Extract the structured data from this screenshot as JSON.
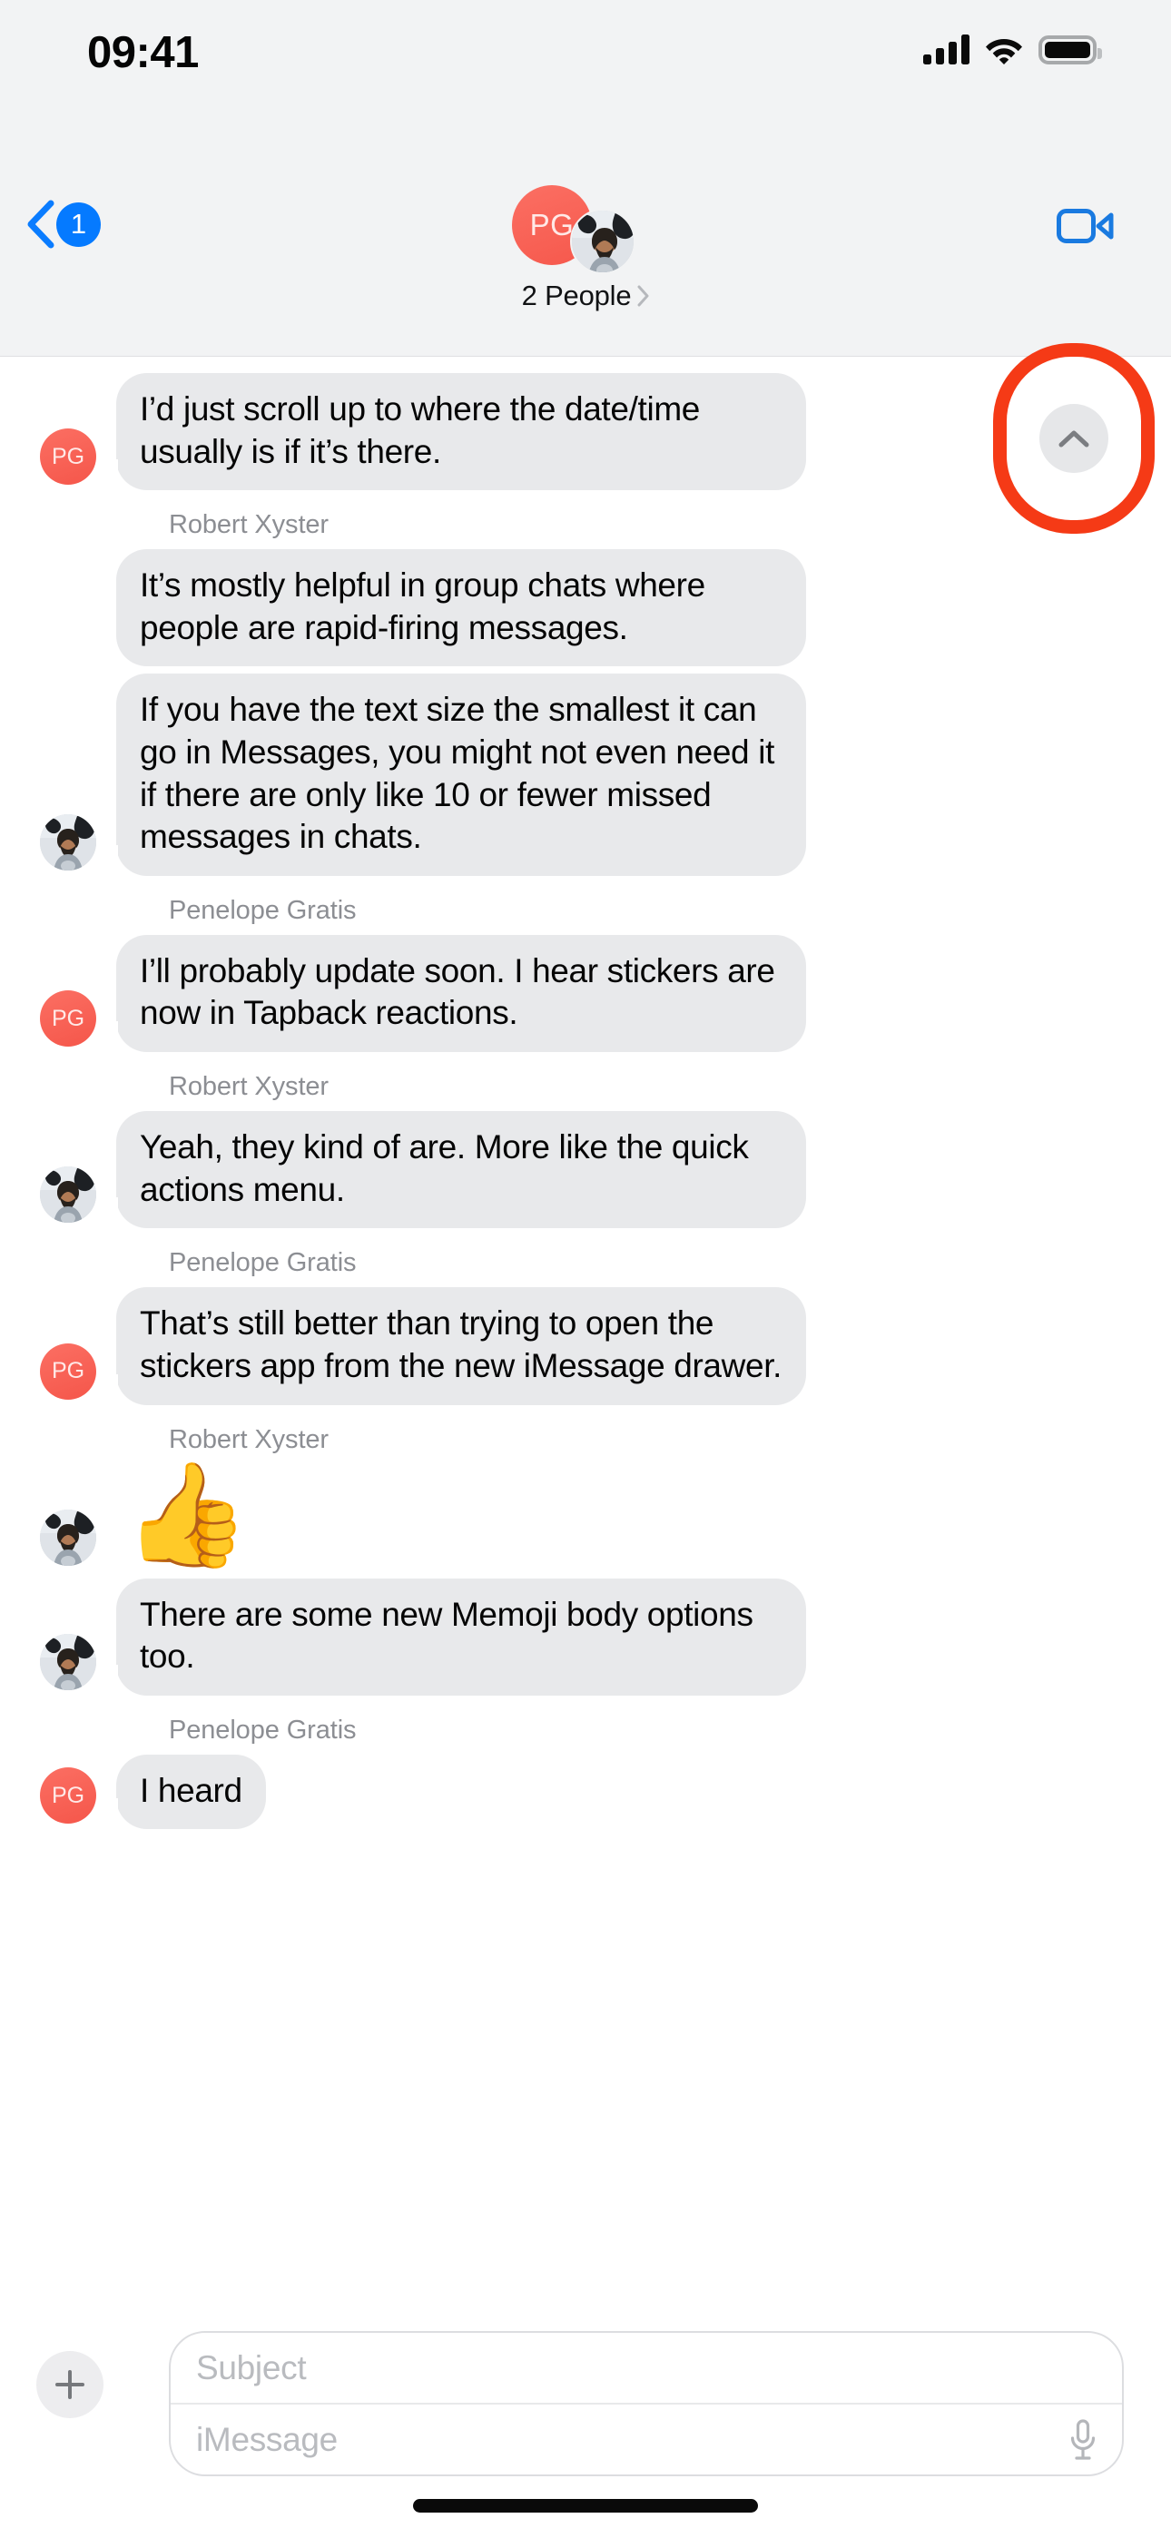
{
  "status_bar": {
    "time": "09:41",
    "cellular_icon": "signal-bars-icon",
    "wifi_icon": "wifi-icon",
    "battery_icon": "battery-full-icon"
  },
  "nav_bar": {
    "back_icon": "chevron-left-icon",
    "back_badge_count": "1",
    "group_avatar_initials": "PG",
    "second_avatar": "contact-photo-avatar",
    "title": "2 People",
    "title_chevron_icon": "chevron-right-icon",
    "facetime_icon": "video-camera-icon"
  },
  "jump_button": {
    "icon": "chevron-up-icon",
    "highlight_color": "#f53a16",
    "name": "scroll-to-unread-button"
  },
  "conversation": {
    "participants": {
      "penelope": {
        "name": "Penelope Gratis",
        "initials": "PG",
        "avatar_color": "#f6584c"
      },
      "robert": {
        "name": "Robert Xyster",
        "avatar": "contact-photo-avatar"
      }
    },
    "messages": [
      {
        "sender": "Penelope Gratis",
        "avatar_type": "initials",
        "initials": "PG",
        "show_label": false,
        "show_avatar": true,
        "text": "I’d just scroll up to where the date/time usually is if it’s there.",
        "type": "text"
      },
      {
        "sender": "Robert Xyster",
        "avatar_type": "photo",
        "initials": "",
        "show_label": true,
        "show_avatar": false,
        "text": "It’s mostly helpful in group chats where people are rapid-firing messages.",
        "type": "text"
      },
      {
        "sender": "Robert Xyster",
        "avatar_type": "photo",
        "initials": "",
        "show_label": false,
        "show_avatar": true,
        "text": "If you have the text size the smallest it can go in Messages, you might not even need it if there are only like 10 or fewer missed messages in chats.",
        "type": "text"
      },
      {
        "sender": "Penelope Gratis",
        "avatar_type": "initials",
        "initials": "PG",
        "show_label": true,
        "show_avatar": true,
        "text": "I’ll probably update soon. I hear stickers are now in Tapback reactions.",
        "type": "text"
      },
      {
        "sender": "Robert Xyster",
        "avatar_type": "photo",
        "initials": "",
        "show_label": true,
        "show_avatar": true,
        "text": "Yeah, they kind of are. More like the quick actions menu.",
        "type": "text"
      },
      {
        "sender": "Penelope Gratis",
        "avatar_type": "initials",
        "initials": "PG",
        "show_label": true,
        "show_avatar": true,
        "text": "That’s still better than trying to open the stickers app from the new iMessage drawer.",
        "type": "text"
      },
      {
        "sender": "Robert Xyster",
        "avatar_type": "photo",
        "initials": "",
        "show_label": true,
        "show_avatar": true,
        "text": "👍",
        "type": "emoji"
      },
      {
        "sender": "Robert Xyster",
        "avatar_type": "photo",
        "initials": "",
        "show_label": false,
        "show_avatar": true,
        "text": "There are some new Memoji body options too.",
        "type": "text"
      },
      {
        "sender": "Penelope Gratis",
        "avatar_type": "initials",
        "initials": "PG",
        "show_label": true,
        "show_avatar": true,
        "text": "I heard",
        "type": "text"
      }
    ]
  },
  "composer": {
    "plus_icon": "plus-icon",
    "subject_placeholder": "Subject",
    "message_placeholder": "iMessage",
    "mic_icon": "microphone-icon"
  },
  "home_indicator": "home-indicator"
}
